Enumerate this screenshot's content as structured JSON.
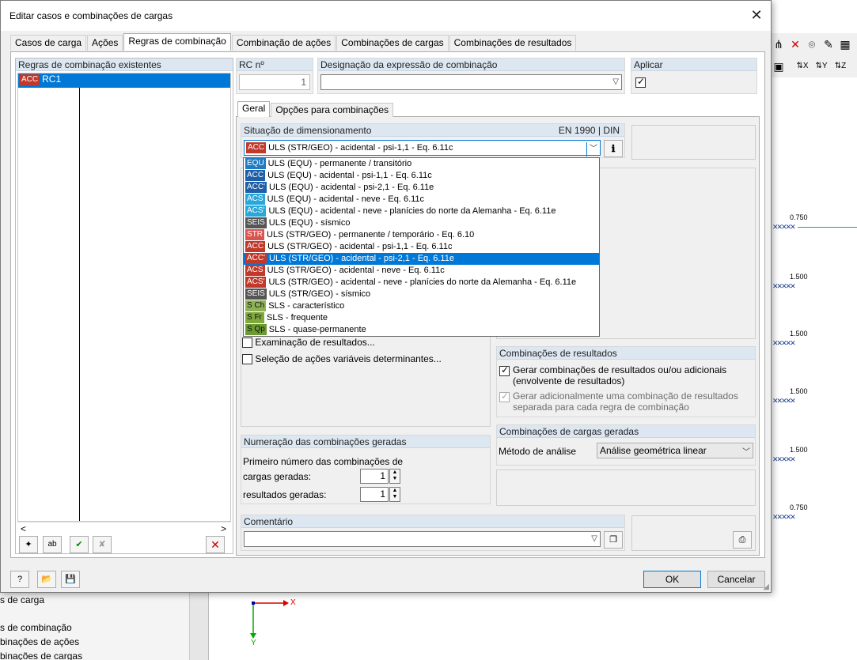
{
  "background": {
    "sidebar_lines": [
      "s de carga",
      "s de combinação",
      "binações de ações",
      "binações de cargas"
    ],
    "canvas_labels": [
      "0.750",
      "1.500",
      "1.500",
      "1.500",
      "1.500",
      "0.750"
    ],
    "axis_x": "X",
    "axis_y": "Y"
  },
  "dialog": {
    "title": "Editar casos e combinações de cargas",
    "tabs": [
      "Casos de carga",
      "Ações",
      "Regras de combinação",
      "Combinação de ações",
      "Combinações de cargas",
      "Combinações de resultados"
    ],
    "active_tab": "Regras de combinação"
  },
  "rules_list": {
    "header": "Regras de combinação existentes",
    "items": [
      {
        "badge": "ACC",
        "label": "RC1"
      }
    ],
    "scroll_left": "<",
    "scroll_right": ">"
  },
  "rc": {
    "header": "RC nº",
    "value": "1"
  },
  "designation": {
    "header": "Designação da expressão de combinação",
    "value": ""
  },
  "apply": {
    "header": "Aplicar",
    "checked": true
  },
  "subtabs": [
    "Geral",
    "Opções para combinações"
  ],
  "situation": {
    "header": "Situação de dimensionamento",
    "standard": "EN 1990 | DIN",
    "selected_badge": "ACC",
    "selected_label": "ULS (STR/GEO) - acidental - psi-1,1 - Eq. 6.11c"
  },
  "dropdown_options": [
    {
      "badge": "EQU",
      "label": "ULS (EQU) - permanente / transitório"
    },
    {
      "badge": "ACC",
      "label": "ULS (EQU) - acidental - psi-1,1 - Eq. 6.11c"
    },
    {
      "badge": "ACC'",
      "label": "ULS (EQU) - acidental - psi-2,1 - Eq. 6.11e"
    },
    {
      "badge": "ACS",
      "label": "ULS (EQU) - acidental - neve - Eq. 6.11c"
    },
    {
      "badge": "ACS'",
      "label": "ULS (EQU) - acidental - neve - planícies do norte da Alemanha - Eq. 6.11e"
    },
    {
      "badge": "SEIS",
      "label": "ULS (EQU) - sísmico"
    },
    {
      "badge": "STR",
      "label": "ULS (STR/GEO) - permanente / temporário - Eq. 6.10"
    },
    {
      "badge": "ACC",
      "label": "ULS (STR/GEO) - acidental - psi-1,1 - Eq. 6.11c"
    },
    {
      "badge": "ACC'",
      "label": "ULS (STR/GEO) - acidental - psi-2,1 - Eq. 6.11e"
    },
    {
      "badge": "ACS",
      "label": "ULS (STR/GEO) - acidental - neve - Eq. 6.11c"
    },
    {
      "badge": "ACS'",
      "label": "ULS (STR/GEO) - acidental - neve - planícies do norte da Alemanha - Eq. 6.11e"
    },
    {
      "badge": "SEIS",
      "label": "ULS (STR/GEO) - sísmico"
    },
    {
      "badge": "S Ch",
      "label": "SLS - característico"
    },
    {
      "badge": "S Fr",
      "label": "SLS - frequente"
    },
    {
      "badge": "S Qp",
      "label": "SLS - quase-permanente"
    }
  ],
  "options": {
    "exam_results": "Examinação de resultados...",
    "select_variable": "Seleção de ações variáveis determinantes..."
  },
  "result_combos": {
    "header": "Combinações de resultados",
    "gen_label": "Gerar combinações de resultados ou/ou adicionais (envolvente de resultados)",
    "gen_checked": true,
    "extra_label": "Gerar adicionalmente uma combinação de resultados separada para cada regra de combinação",
    "extra_checked": true
  },
  "numbering": {
    "header": "Numeração das combinações geradas",
    "first_label": "Primeiro número das combinações de",
    "loads_label": "cargas geradas:",
    "loads_value": "1",
    "results_label": "resultados geradas:",
    "results_value": "1"
  },
  "generated_loads": {
    "header": "Combinações de cargas geradas",
    "method_label": "Método de análise",
    "method_value": "Análise geométrica linear"
  },
  "comment": {
    "header": "Comentário",
    "value": ""
  },
  "buttons": {
    "ok": "OK",
    "cancel": "Cancelar"
  }
}
